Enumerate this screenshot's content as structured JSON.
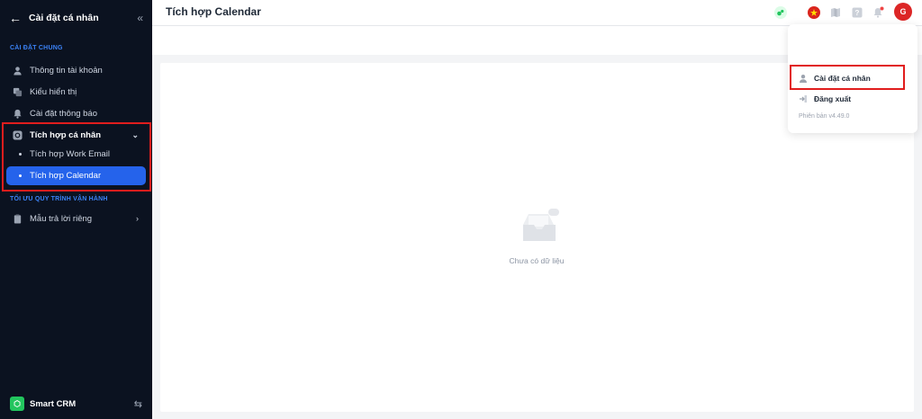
{
  "sidebar": {
    "title": "Cài đặt cá nhân",
    "section_general": "CÀI ĐẶT CHUNG",
    "items": [
      {
        "label": "Thông tin tài khoản"
      },
      {
        "label": "Kiểu hiển thị"
      },
      {
        "label": "Cài đặt thông báo"
      },
      {
        "label": "Tích hợp cá nhân"
      }
    ],
    "sub_items": [
      {
        "label": "Tích hợp Work Email"
      },
      {
        "label": "Tích hợp Calendar"
      }
    ],
    "section_workflow": "TỐI ƯU QUY TRÌNH VẬN HÀNH",
    "workflow_items": [
      {
        "label": "Mẫu trả lời riêng"
      }
    ],
    "brand": "Smart CRM"
  },
  "header": {
    "title": "Tích hợp Calendar",
    "avatar_initial": "G"
  },
  "main": {
    "empty_text": "Chưa có dữ liệu"
  },
  "dropdown": {
    "items": [
      {
        "label": "Cài đặt cá nhân"
      },
      {
        "label": "Đăng xuất"
      }
    ],
    "version": "Phiên bản v4.49.0"
  },
  "colors": {
    "sidebar_bg": "#0b1220",
    "accent": "#2563eb",
    "highlight": "#e11d1d",
    "avatar_bg": "#dc2626"
  }
}
